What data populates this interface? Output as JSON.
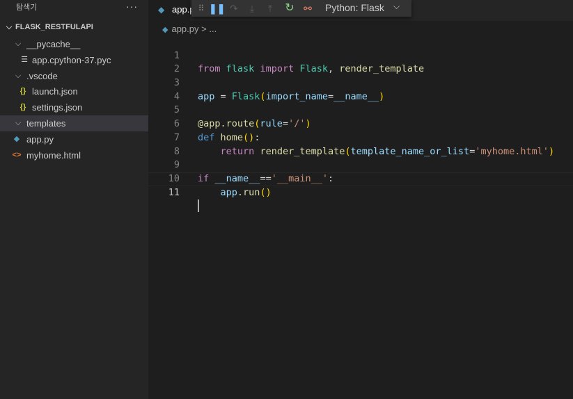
{
  "sidebar": {
    "title": "탐색기",
    "more": "···",
    "items": [
      {
        "label": "FLASK_RESTFULAPI",
        "icon": "chevron-down-icon"
      },
      {
        "label": "__pycache__",
        "icon": "chevron-down-icon"
      },
      {
        "label": "app.cpython-37.pyc",
        "icon": "file-lines-icon"
      },
      {
        "label": ".vscode",
        "icon": "chevron-down-icon"
      },
      {
        "label": "launch.json",
        "icon": "json-braces-icon"
      },
      {
        "label": "settings.json",
        "icon": "json-braces-icon"
      },
      {
        "label": "templates",
        "icon": "chevron-right-icon"
      },
      {
        "label": "app.py",
        "icon": "python-icon"
      },
      {
        "label": "myhome.html",
        "icon": "html-code-icon"
      }
    ]
  },
  "tabs": [
    {
      "label": "app.py"
    }
  ],
  "debug_toolbar": {
    "config": "Python: Flask",
    "buttons": [
      "drag-handle-icon",
      "pause-icon",
      "step-over-icon",
      "step-into-icon",
      "step-out-icon",
      "restart-icon",
      "disconnect-icon"
    ]
  },
  "breadcrumb": {
    "file": "app.py",
    "separator": ">",
    "more": "..."
  },
  "code": {
    "line_numbers": [
      "1",
      "2",
      "3",
      "4",
      "5",
      "6",
      "7",
      "8",
      "9",
      "10",
      "11"
    ],
    "l1": {
      "a": "from",
      "b": " ",
      "c": "flask",
      "d": " ",
      "e": "import",
      "f": " ",
      "g": "Flask",
      "h": ", ",
      "i": "render_template"
    },
    "l3": {
      "a": "app",
      "b": " = ",
      "c": "Flask",
      "d": "(",
      "e": "import_name",
      "f": "=",
      "g": "__name__",
      "h": ")"
    },
    "l5": {
      "a": "@app.route",
      "b": "(",
      "c": "rule",
      "d": "=",
      "e": "'/'",
      "f": ")"
    },
    "l6": {
      "a": "def",
      "b": " ",
      "c": "home",
      "d": "()",
      "e": ":"
    },
    "l7": {
      "ind": "    ",
      "a": "return",
      "b": " ",
      "c": "render_template",
      "d": "(",
      "e": "template_name_or_list",
      "f": "=",
      "g": "'myhome.html'",
      "h": ")"
    },
    "l9": {
      "a": "if",
      "b": " ",
      "c": "__name__",
      "d": "==",
      "e": "'__main__'",
      "f": ":"
    },
    "l10": {
      "ind": "    ",
      "a": "app",
      "b": ".",
      "c": "run",
      "d": "()"
    }
  }
}
